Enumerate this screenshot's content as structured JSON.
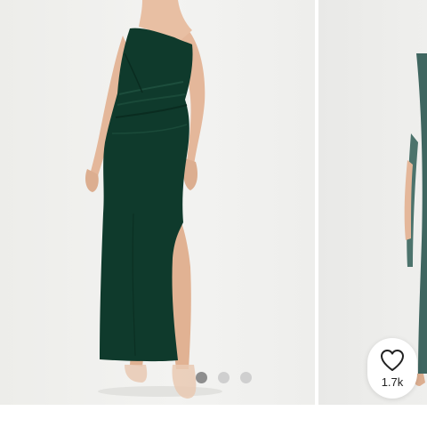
{
  "gallery": {
    "total_slides": 3,
    "active_slide": 1
  },
  "favorite": {
    "count": "1.7k",
    "icon": "heart-outline-icon"
  },
  "colors": {
    "dress": "#0f3a2c",
    "dress_alt": "#3f6660",
    "background": "#efefed",
    "dot_active": "#8e8e8e",
    "dot_inactive": "#cfcfcf"
  }
}
